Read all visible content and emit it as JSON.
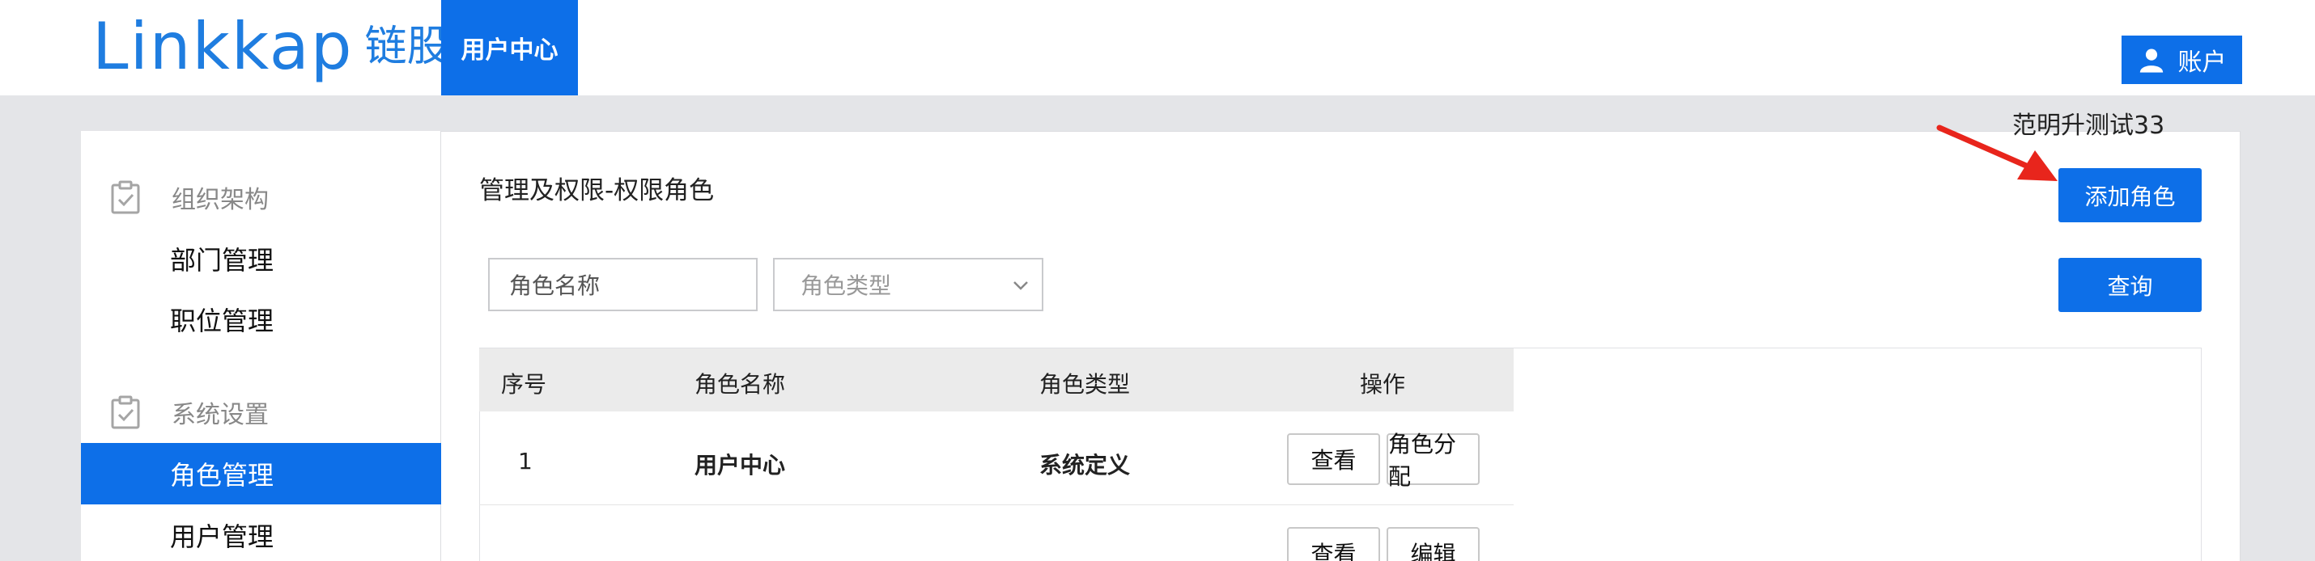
{
  "header": {
    "logo_en": "Linkkap",
    "logo_cn": "链股",
    "active_tab": "用户中心",
    "account_label": "账户"
  },
  "user": {
    "name": "范明升测试33"
  },
  "sidebar": {
    "groups": [
      {
        "label": "组织架构",
        "items": [
          "部门管理",
          "职位管理"
        ]
      },
      {
        "label": "系统设置",
        "items": [
          "角色管理",
          "用户管理"
        ]
      }
    ],
    "active_item": "角色管理"
  },
  "main": {
    "title": "管理及权限-权限角色",
    "add_button": "添加角色",
    "query_button": "查询",
    "filters": {
      "role_name_placeholder": "角色名称",
      "role_type_placeholder": "角色类型"
    },
    "table": {
      "columns": [
        "序号",
        "角色名称",
        "角色类型",
        "操作"
      ],
      "rows": [
        {
          "index": "1",
          "name": "用户中心",
          "type": "系统定义",
          "actions": [
            "查看",
            "角色分配"
          ]
        },
        {
          "index": "",
          "name": "",
          "type": "",
          "actions": [
            "查看",
            "编辑"
          ]
        }
      ]
    }
  },
  "colors": {
    "primary": "#0d6fe8",
    "logo": "#1f7de0",
    "annotation_arrow": "#e8251c"
  }
}
